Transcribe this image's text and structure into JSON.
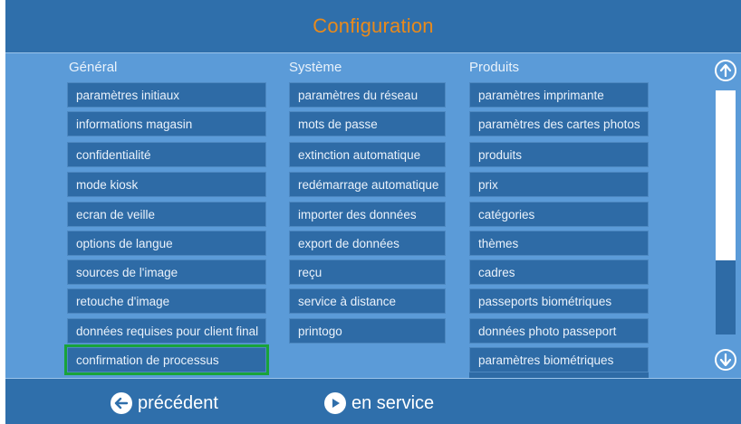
{
  "header": {
    "title": "Configuration"
  },
  "columns": [
    {
      "title": "Général",
      "items": [
        "paramètres initiaux",
        "informations magasin",
        "confidentialité",
        "mode kiosk",
        "ecran de veille",
        "options de langue",
        "sources de l'image",
        "retouche d'image",
        "données requises pour client final",
        "confirmation de processus"
      ],
      "selected_index": 9
    },
    {
      "title": "Système",
      "items": [
        "paramètres du réseau",
        "mots de passe",
        "extinction automatique",
        "redémarrage automatique",
        "importer des données",
        "export de données",
        "reçu",
        "service à distance",
        "printogo"
      ]
    },
    {
      "title": "Produits",
      "items": [
        "paramètres imprimante",
        "paramètres des cartes photos",
        "produits",
        "prix",
        "catégories",
        "thèmes",
        "cadres",
        "passeports biométriques",
        "données photo passeport",
        "paramètres biométriques"
      ]
    }
  ],
  "footer": {
    "back_label": "précédent",
    "service_label": "en service"
  },
  "colors": {
    "background": "#5b9bd8",
    "bar": "#2f6fab",
    "item": "#2e6ba6",
    "title": "#e88a1c",
    "selection": "#19a33a"
  },
  "icons": {
    "scroll_up": "arrow-up-circle-icon",
    "scroll_down": "arrow-down-circle-icon",
    "back": "arrow-left-circle-icon",
    "service": "play-circle-icon"
  }
}
